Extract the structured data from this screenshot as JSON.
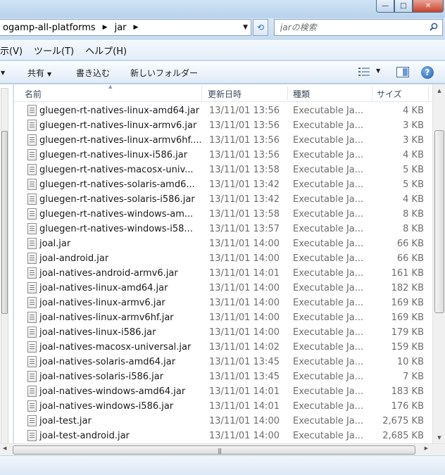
{
  "window": {
    "minimize": "—",
    "maximize": "□",
    "close": "✕"
  },
  "address": {
    "crumbs": [
      "ogamp-all-platforms",
      "jar"
    ],
    "refresh_icon": "refresh-icon"
  },
  "search": {
    "placeholder": "jarの検索"
  },
  "menu": {
    "items": [
      "示(V)",
      "ツール(T)",
      "ヘルプ(H)"
    ]
  },
  "toolbar": {
    "share": "共有",
    "burn": "書き込む",
    "new_folder": "新しいフォルダー",
    "help": "?"
  },
  "columns": {
    "name": "名前",
    "date": "更新日時",
    "type": "種類",
    "size": "サイズ"
  },
  "files": [
    {
      "name": "gluegen-rt-natives-linux-amd64.jar",
      "date": "13/11/01 13:56",
      "type": "Executable Ja...",
      "size": "4 KB"
    },
    {
      "name": "gluegen-rt-natives-linux-armv6.jar",
      "date": "13/11/01 13:56",
      "type": "Executable Ja...",
      "size": "3 KB"
    },
    {
      "name": "gluegen-rt-natives-linux-armv6hf....",
      "date": "13/11/01 13:56",
      "type": "Executable Ja...",
      "size": "3 KB"
    },
    {
      "name": "gluegen-rt-natives-linux-i586.jar",
      "date": "13/11/01 13:56",
      "type": "Executable Ja...",
      "size": "4 KB"
    },
    {
      "name": "gluegen-rt-natives-macosx-univ...",
      "date": "13/11/01 13:58",
      "type": "Executable Ja...",
      "size": "5 KB"
    },
    {
      "name": "gluegen-rt-natives-solaris-amd6...",
      "date": "13/11/01 13:42",
      "type": "Executable Ja...",
      "size": "5 KB"
    },
    {
      "name": "gluegen-rt-natives-solaris-i586.jar",
      "date": "13/11/01 13:42",
      "type": "Executable Ja...",
      "size": "4 KB"
    },
    {
      "name": "gluegen-rt-natives-windows-am...",
      "date": "13/11/01 13:58",
      "type": "Executable Ja...",
      "size": "8 KB"
    },
    {
      "name": "gluegen-rt-natives-windows-i58...",
      "date": "13/11/01 13:57",
      "type": "Executable Ja...",
      "size": "8 KB"
    },
    {
      "name": "joal.jar",
      "date": "13/11/01 14:00",
      "type": "Executable Ja...",
      "size": "66 KB"
    },
    {
      "name": "joal-android.jar",
      "date": "13/11/01 14:00",
      "type": "Executable Ja...",
      "size": "66 KB"
    },
    {
      "name": "joal-natives-android-armv6.jar",
      "date": "13/11/01 14:01",
      "type": "Executable Ja...",
      "size": "161 KB"
    },
    {
      "name": "joal-natives-linux-amd64.jar",
      "date": "13/11/01 14:00",
      "type": "Executable Ja...",
      "size": "182 KB"
    },
    {
      "name": "joal-natives-linux-armv6.jar",
      "date": "13/11/01 14:00",
      "type": "Executable Ja...",
      "size": "169 KB"
    },
    {
      "name": "joal-natives-linux-armv6hf.jar",
      "date": "13/11/01 14:00",
      "type": "Executable Ja...",
      "size": "169 KB"
    },
    {
      "name": "joal-natives-linux-i586.jar",
      "date": "13/11/01 14:00",
      "type": "Executable Ja...",
      "size": "179 KB"
    },
    {
      "name": "joal-natives-macosx-universal.jar",
      "date": "13/11/01 14:02",
      "type": "Executable Ja...",
      "size": "159 KB"
    },
    {
      "name": "joal-natives-solaris-amd64.jar",
      "date": "13/11/01 13:45",
      "type": "Executable Ja...",
      "size": "10 KB"
    },
    {
      "name": "joal-natives-solaris-i586.jar",
      "date": "13/11/01 13:45",
      "type": "Executable Ja...",
      "size": "7 KB"
    },
    {
      "name": "joal-natives-windows-amd64.jar",
      "date": "13/11/01 14:01",
      "type": "Executable Ja...",
      "size": "183 KB"
    },
    {
      "name": "joal-natives-windows-i586.jar",
      "date": "13/11/01 14:01",
      "type": "Executable Ja...",
      "size": "176 KB"
    },
    {
      "name": "joal-test.jar",
      "date": "13/11/01 14:00",
      "type": "Executable Ja...",
      "size": "2,675 KB"
    },
    {
      "name": "joal-test-android.jar",
      "date": "13/11/01 14:00",
      "type": "Executable Ja...",
      "size": "2,685 KB"
    }
  ]
}
